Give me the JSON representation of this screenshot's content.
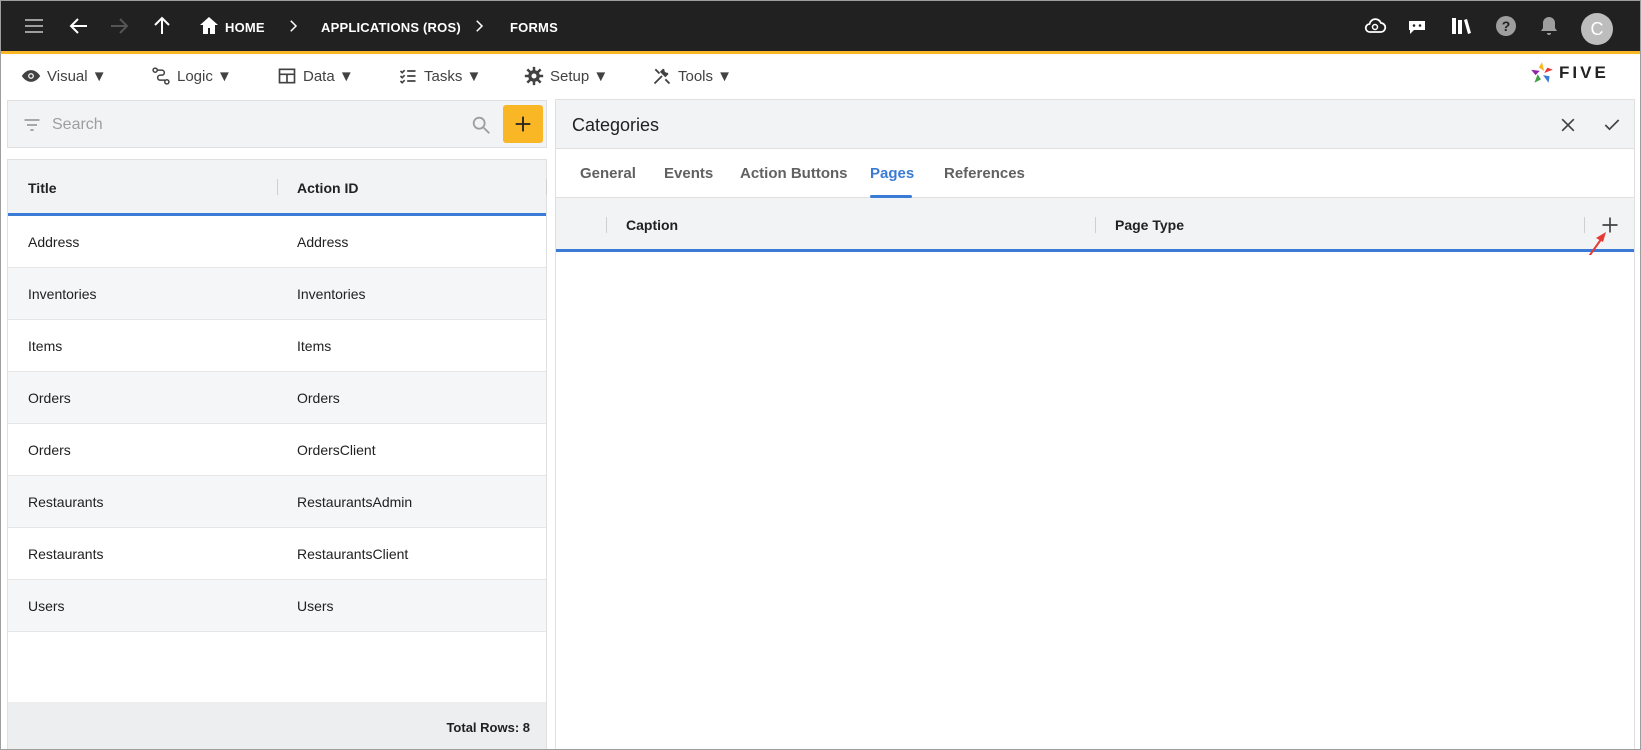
{
  "breadcrumb": {
    "home": "HOME",
    "application": "APPLICATIONS (ROS)",
    "forms": "FORMS"
  },
  "user": {
    "avatar_initial": "C"
  },
  "menu": {
    "visual": "Visual ▼",
    "logic": "Logic ▼",
    "data": "Data ▼",
    "tasks": "Tasks ▼",
    "setup": "Setup ▼",
    "tools": "Tools ▼"
  },
  "logo": {
    "text": "FIVE"
  },
  "search": {
    "placeholder": "Search"
  },
  "list": {
    "columns": [
      "Title",
      "Action ID"
    ],
    "rows": [
      {
        "title": "Address",
        "action_id": "Address"
      },
      {
        "title": "Inventories",
        "action_id": "Inventories"
      },
      {
        "title": "Items",
        "action_id": "Items"
      },
      {
        "title": "Orders",
        "action_id": "Orders"
      },
      {
        "title": "Orders",
        "action_id": "OrdersClient"
      },
      {
        "title": "Restaurants",
        "action_id": "RestaurantsAdmin"
      },
      {
        "title": "Restaurants",
        "action_id": "RestaurantsClient"
      },
      {
        "title": "Users",
        "action_id": "Users"
      }
    ],
    "total_rows": "Total Rows: 8"
  },
  "form": {
    "title": "Categories",
    "tabs": [
      "General",
      "Events",
      "Action Buttons",
      "Pages",
      "References"
    ],
    "active_tab": "Pages",
    "grid_columns": [
      "Caption",
      "Page Type"
    ]
  },
  "colors": {
    "topbar": "#212121",
    "accent": "#f9b625",
    "primary": "#3a7bd5",
    "annotation": "#e53935"
  }
}
